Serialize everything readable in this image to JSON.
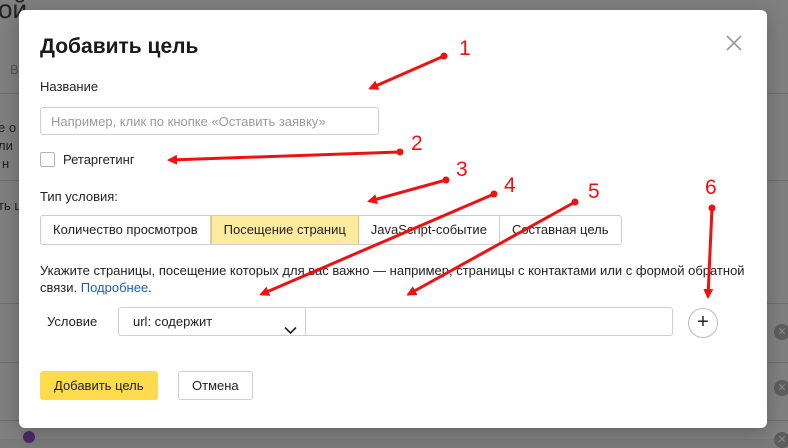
{
  "background": {
    "title_fragment": "ой",
    "fragments": [
      "В",
      "е о",
      "ли",
      "н",
      "ть ц"
    ]
  },
  "modal": {
    "title": "Добавить цель",
    "name_label": "Название",
    "name_placeholder": "Например, клик по кнопке «Оставить заявку»",
    "name_value": "",
    "retargeting_label": "Ретаргетинг",
    "retargeting_checked": false,
    "condition_type_label": "Тип условия:",
    "condition_types": [
      {
        "label": "Количество просмотров",
        "active": false
      },
      {
        "label": "Посещение страниц",
        "active": true
      },
      {
        "label": "JavaScript-событие",
        "active": false
      },
      {
        "label": "Составная цель",
        "active": false
      }
    ],
    "hint_text": "Укажите страницы, посещение которых для вас важно — например, страницы с контактами или с формой обратной связи. ",
    "hint_link": "Подробнее",
    "hint_end": ".",
    "condition_label": "Условие",
    "condition_select": "url: содержит",
    "condition_value": "",
    "add_condition_symbol": "+",
    "submit_label": "Добавить цель",
    "cancel_label": "Отмена"
  },
  "annotations": {
    "color": "#ee1111",
    "numbers": [
      "1",
      "2",
      "3",
      "4",
      "5",
      "6"
    ]
  },
  "colors": {
    "active_segment": "#ffeba0",
    "primary_button": "#ffdb4d",
    "link": "#1a5fb0"
  }
}
